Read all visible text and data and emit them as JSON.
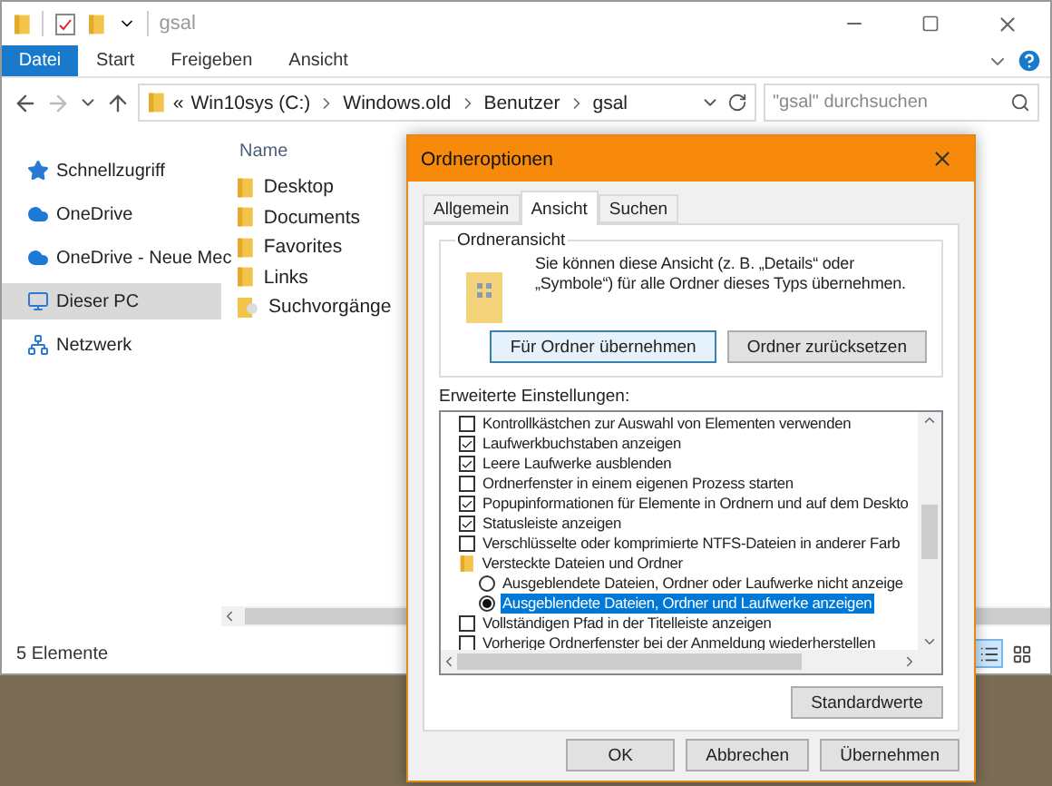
{
  "window": {
    "title": "gsal"
  },
  "file_tab": "Datei",
  "ribbon_tabs": [
    {
      "label": "Start"
    },
    {
      "label": "Freigeben"
    },
    {
      "label": "Ansicht"
    }
  ],
  "address": {
    "prefix": "«",
    "segments": [
      "Win10sys (C:)",
      "Windows.old",
      "Benutzer",
      "gsal"
    ]
  },
  "search": {
    "placeholder": "\"gsal\" durchsuchen"
  },
  "nav_items": [
    {
      "label": "Schnellzugriff",
      "kind": "star",
      "selected": false
    },
    {
      "label": "OneDrive",
      "kind": "cloud",
      "selected": false
    },
    {
      "label": "OneDrive - Neue Mec",
      "kind": "cloud",
      "selected": false
    },
    {
      "label": "Dieser PC",
      "kind": "pc",
      "selected": true
    },
    {
      "label": "Netzwerk",
      "kind": "network",
      "selected": false
    }
  ],
  "column_header": "Name",
  "files": [
    {
      "name": "Desktop",
      "kind": "folder"
    },
    {
      "name": "Documents",
      "kind": "folder"
    },
    {
      "name": "Favorites",
      "kind": "folder"
    },
    {
      "name": "Links",
      "kind": "folder"
    },
    {
      "name": "Suchvorgänge",
      "kind": "search"
    }
  ],
  "status_bar": {
    "text": "5 Elemente",
    "views": [
      {
        "kind": "details",
        "selected": true
      },
      {
        "kind": "tiles",
        "selected": false
      }
    ]
  },
  "dialog": {
    "title": "Ordneroptionen",
    "tabs": [
      {
        "label": "Allgemein",
        "selected": false
      },
      {
        "label": "Ansicht",
        "selected": true
      },
      {
        "label": "Suchen",
        "selected": false
      }
    ],
    "group_title": "Ordneransicht",
    "group_text": "Sie können diese Ansicht (z. B. „Details“ oder „Symbole“) für alle Ordner dieses Typs übernehmen.",
    "group_buttons": [
      {
        "label": "Für Ordner übernehmen",
        "focused": true
      },
      {
        "label": "Ordner zurücksetzen",
        "focused": false
      }
    ],
    "settings_label": "Erweiterte Einstellungen:",
    "settings": [
      {
        "kind": "checkbox",
        "label": "Kontrollkästchen zur Auswahl von Elementen verwenden",
        "checked": false,
        "selected": false
      },
      {
        "kind": "checkbox",
        "label": "Laufwerkbuchstaben anzeigen",
        "checked": true,
        "selected": false
      },
      {
        "kind": "checkbox",
        "label": "Leere Laufwerke ausblenden",
        "checked": true,
        "selected": false
      },
      {
        "kind": "checkbox",
        "label": "Ordnerfenster in einem eigenen Prozess starten",
        "checked": false,
        "selected": false
      },
      {
        "kind": "checkbox",
        "label": "Popupinformationen für Elemente in Ordnern und auf dem Deskto",
        "checked": true,
        "selected": false
      },
      {
        "kind": "checkbox",
        "label": "Statusleiste anzeigen",
        "checked": true,
        "selected": false
      },
      {
        "kind": "checkbox",
        "label": "Verschlüsselte oder komprimierte NTFS-Dateien in anderer Farb",
        "checked": false,
        "selected": false
      },
      {
        "kind": "folder",
        "label": "Versteckte Dateien und Ordner",
        "selected": false,
        "children": [
          {
            "kind": "radio",
            "label": "Ausgeblendete Dateien, Ordner oder Laufwerke nicht anzeige",
            "checked": false,
            "selected": false
          },
          {
            "kind": "radio",
            "label": "Ausgeblendete Dateien, Ordner und Laufwerke anzeigen",
            "checked": true,
            "selected": true
          }
        ]
      },
      {
        "kind": "checkbox",
        "label": "Vollständigen Pfad in der Titelleiste anzeigen",
        "checked": false,
        "selected": false
      },
      {
        "kind": "checkbox",
        "label": "Vorherige Ordnerfenster bei der Anmeldung wiederherstellen",
        "checked": false,
        "selected": false
      }
    ],
    "defaults_button": "Standardwerte",
    "footer_buttons": [
      "OK",
      "Abbrechen",
      "Übernehmen"
    ]
  }
}
